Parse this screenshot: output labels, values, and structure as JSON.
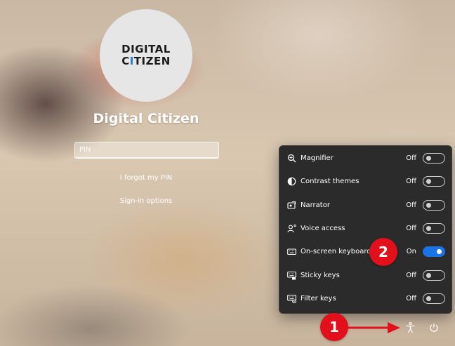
{
  "user": {
    "logo_line1": "DIGITAL",
    "logo_line2_start": "C",
    "logo_line2_accent": "I",
    "logo_line2_end": "TIZEN",
    "name": "Digital Citizen"
  },
  "signin": {
    "pin_placeholder": "PIN",
    "forgot_pin": "I forgot my PIN",
    "signin_options": "Sign-in options"
  },
  "accessibility_menu": {
    "items": [
      {
        "label": "Magnifier",
        "state": "Off",
        "on": false,
        "icon": "magnifier-icon"
      },
      {
        "label": "Contrast themes",
        "state": "Off",
        "on": false,
        "icon": "contrast-icon"
      },
      {
        "label": "Narrator",
        "state": "Off",
        "on": false,
        "icon": "narrator-icon"
      },
      {
        "label": "Voice access",
        "state": "Off",
        "on": false,
        "icon": "voice-access-icon"
      },
      {
        "label": "On-screen keyboard",
        "state": "On",
        "on": true,
        "icon": "keyboard-icon"
      },
      {
        "label": "Sticky keys",
        "state": "Off",
        "on": false,
        "icon": "sticky-keys-icon"
      },
      {
        "label": "Filter keys",
        "state": "Off",
        "on": false,
        "icon": "filter-keys-icon"
      }
    ]
  },
  "annotations": {
    "badge1": "1",
    "badge2": "2"
  },
  "colors": {
    "annotation_red": "#e3101b",
    "toggle_on": "#1a73e8",
    "flyout_bg": "#2b2b2b",
    "logo_accent": "#1e7fd8"
  },
  "bottom_bar": {
    "icons": [
      "accessibility-icon",
      "power-icon"
    ]
  }
}
